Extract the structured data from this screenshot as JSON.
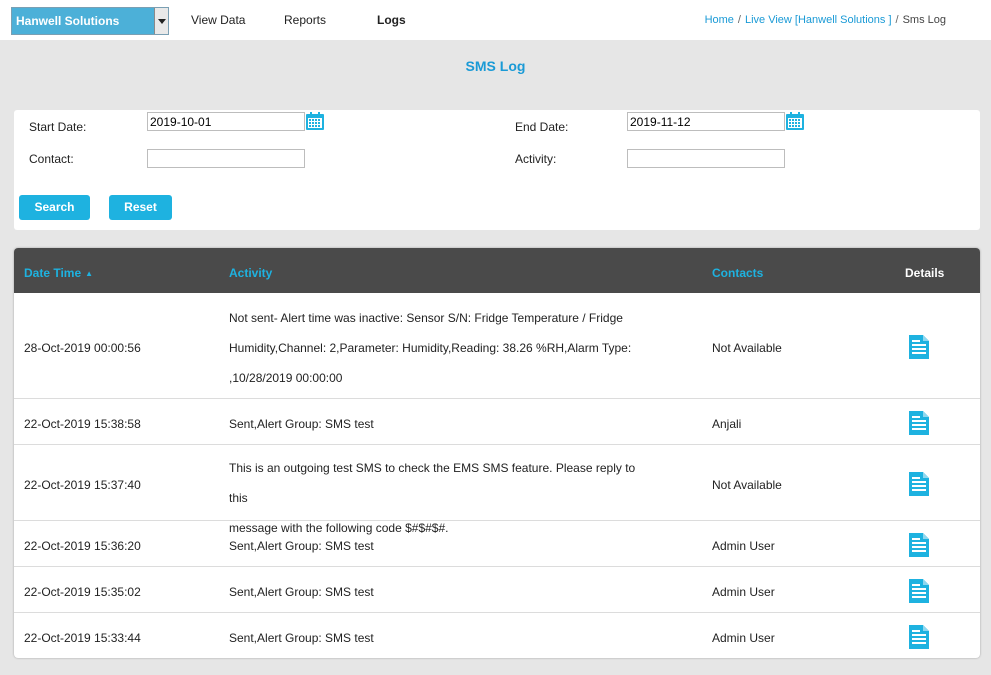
{
  "nav": {
    "site_selector": "Hanwell Solutions",
    "items": [
      "View Data",
      "Reports",
      "Logs"
    ],
    "active": "Logs"
  },
  "breadcrumb": {
    "home": "Home",
    "live_view": "Live View [Hanwell Solutions ]",
    "current": "Sms Log",
    "separator": "/"
  },
  "page_title": "SMS Log",
  "filters": {
    "start_date_label": "Start Date:",
    "start_date_value": "2019-10-01",
    "end_date_label": "End Date:",
    "end_date_value": "2019-11-12",
    "contact_label": "Contact:",
    "contact_value": "",
    "activity_label": "Activity:",
    "activity_value": "",
    "search_button": "Search",
    "reset_button": "Reset"
  },
  "table": {
    "headers": {
      "date_time": "Date Time",
      "activity": "Activity",
      "contacts": "Contacts",
      "details": "Details"
    },
    "sort_indicator": "▲",
    "rows": [
      {
        "date_time": "28-Oct-2019 00:00:56",
        "activity_lines": [
          "Not sent- Alert time was inactive: Sensor S/N: Fridge Temperature / Fridge",
          "Humidity,Channel: 2,Parameter: Humidity,Reading: 38.26 %RH,Alarm Type:",
          ",10/28/2019 00:00:00"
        ],
        "contact": "Not Available"
      },
      {
        "date_time": "22-Oct-2019 15:38:58",
        "activity_lines": [
          "Sent,Alert Group: SMS test"
        ],
        "contact": "Anjali"
      },
      {
        "date_time": "22-Oct-2019 15:37:40",
        "activity_lines": [
          "This is an outgoing test SMS to check the EMS SMS feature. Please reply to this",
          "message with the following code $#$#$#."
        ],
        "contact": "Not Available"
      },
      {
        "date_time": "22-Oct-2019 15:36:20",
        "activity_lines": [
          "Sent,Alert Group: SMS test"
        ],
        "contact": "Admin User"
      },
      {
        "date_time": "22-Oct-2019 15:35:02",
        "activity_lines": [
          "Sent,Alert Group: SMS test"
        ],
        "contact": "Admin User"
      },
      {
        "date_time": "22-Oct-2019 15:33:44",
        "activity_lines": [
          "Sent,Alert Group: SMS test"
        ],
        "contact": "Admin User"
      }
    ]
  },
  "colors": {
    "accent": "#1eb2e0",
    "header_bg": "#4a4a4a",
    "selector_bg": "#4cb0d8"
  },
  "icons": {
    "calendar": "calendar-icon",
    "details": "document-icon"
  }
}
